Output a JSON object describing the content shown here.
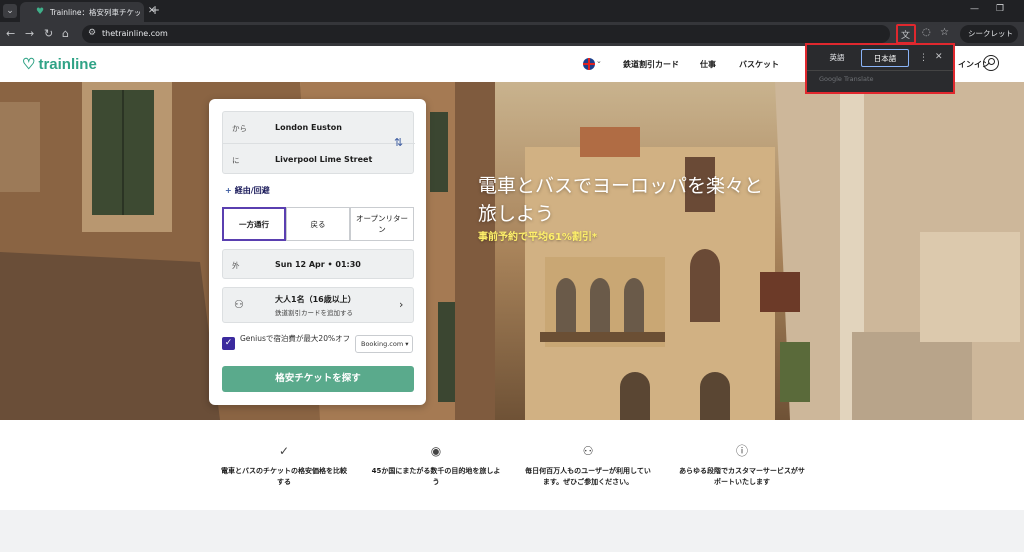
{
  "browser": {
    "tab_title": "Trainline：格安列車チケットの検索",
    "url": "thetrainline.com",
    "incognito_label": "シークレット"
  },
  "translate_popup": {
    "source_lang": "英語",
    "target_lang": "日本語",
    "brand": "Google Translate"
  },
  "header": {
    "logo": "trainline",
    "nav": [
      "鉄道割引カード",
      "仕事",
      "バスケット"
    ],
    "signin": "インイン"
  },
  "hero": {
    "title": "電車とバスでヨーロッパを楽々と旅しよう",
    "subtitle": "事前予約で平均61%割引*"
  },
  "search": {
    "from_label": "から",
    "from_value": "London Euston",
    "to_label": "に",
    "to_value": "Liverpool Lime Street",
    "via_label": "経由/回避",
    "trip_types": [
      "一方通行",
      "戻る",
      "オープンリターン"
    ],
    "selected_trip": "一方通行",
    "outbound_label": "外",
    "outbound_value": "Sun 12 Apr • 01:30",
    "passengers_main": "大人1名（16歳以上）",
    "passengers_sub": "鉄道割引カードを追加する",
    "genius_text": "Geniusで宿泊費が最大20%オフ",
    "genius_checked": true,
    "booking_select": "Booking.com",
    "search_button": "格安チケットを探す"
  },
  "features": [
    {
      "icon": "check-badge-icon",
      "text": "電車とバスのチケットの格安価格を比較する"
    },
    {
      "icon": "location-pin-icon",
      "text": "45か国にまたがる数千の目的地を旅しよう"
    },
    {
      "icon": "users-icon",
      "text": "毎日何百万人ものユーザーが利用しています。ぜひご参加ください。"
    },
    {
      "icon": "info-icon",
      "text": "あらゆる段階でカスタマーサービスがサポートいたします"
    }
  ],
  "colors": {
    "brand_green": "#30a386",
    "cta_green": "#5aaa8c",
    "accent_purple": "#5a3fb0",
    "hero_subtitle": "#fff16a",
    "highlight_red": "#e0282e"
  }
}
